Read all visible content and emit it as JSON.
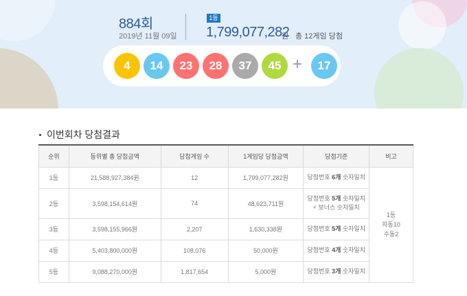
{
  "banner": {
    "draw_number": "884회",
    "draw_date": "2019년 11월 09일",
    "rank_badge": "1등",
    "first_prize_amount": "1,799,077,282",
    "first_prize_unit": "원",
    "first_prize_games": "총 12게임 당첨",
    "winning_numbers": [
      {
        "value": "4",
        "color": "#fbc400"
      },
      {
        "value": "14",
        "color": "#69c8f2"
      },
      {
        "value": "23",
        "color": "#ff7272"
      },
      {
        "value": "28",
        "color": "#ff7272"
      },
      {
        "value": "37",
        "color": "#aaaaaa"
      },
      {
        "value": "45",
        "color": "#b0d840"
      }
    ],
    "plus": "+",
    "bonus_number": {
      "value": "17",
      "color": "#69c8f2"
    }
  },
  "results": {
    "section_title": "이번회차 당첨결과",
    "headers": [
      "순위",
      "등위별 총 당첨금액",
      "당첨게임 수",
      "1게임당 당첨금액",
      "당첨기준",
      "비고"
    ],
    "rows": [
      {
        "rank": "1등",
        "total": "21,588,927,384원",
        "games": "12",
        "per_game": "1,799,077,282원",
        "crit_pre": "당첨번호 ",
        "crit_bold": "6개",
        "crit_post": " 숫자일치",
        "crit_line2": ""
      },
      {
        "rank": "2등",
        "total": "3,598,154,614원",
        "games": "74",
        "per_game": "48,623,711원",
        "crit_pre": "당첨번호 ",
        "crit_bold": "5개",
        "crit_post": " 숫자일치",
        "crit_line2": "+ 보너스 숫자일치"
      },
      {
        "rank": "3등",
        "total": "3,598,155,966원",
        "games": "2,207",
        "per_game": "1,630,338원",
        "crit_pre": "당첨번호 ",
        "crit_bold": "5개",
        "crit_post": " 숫자일치",
        "crit_line2": ""
      },
      {
        "rank": "4등",
        "total": "5,403,800,000원",
        "games": "108,076",
        "per_game": "50,000원",
        "crit_pre": "당첨번호 ",
        "crit_bold": "4개",
        "crit_post": " 숫자일치",
        "crit_line2": ""
      },
      {
        "rank": "5등",
        "total": "9,088,270,000원",
        "games": "1,817,654",
        "per_game": "5,000원",
        "crit_pre": "당첨번호 ",
        "crit_bold": "3개",
        "crit_post": " 숫자일치",
        "crit_line2": ""
      }
    ],
    "note": {
      "line1": "1등",
      "line2": "자동10",
      "line3": "수동2"
    }
  }
}
